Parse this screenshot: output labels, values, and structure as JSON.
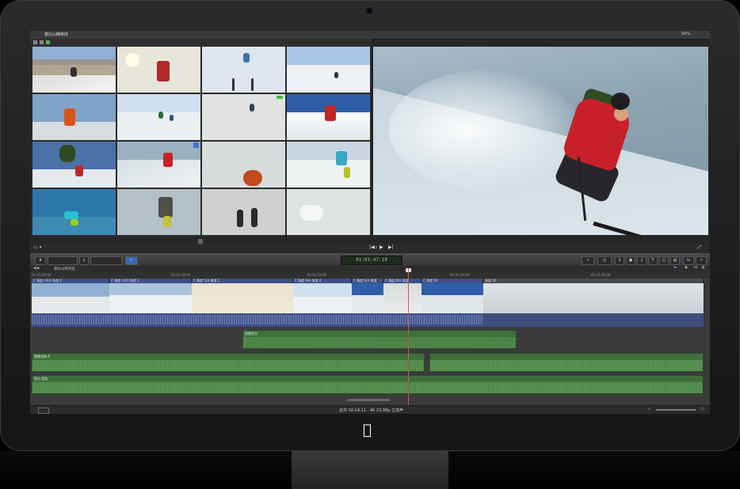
{
  "app": {
    "window_title": "春比山精英娃",
    "zoom_level": "93%",
    "browser_settings_label": "设置"
  },
  "toolbar": {
    "timecode": "01:01:47:10"
  },
  "timeline": {
    "project_name": "春比山精英娃",
    "ruler_ticks": [
      "01:01:00:00",
      "01:01:10:00",
      "01:01:20:00",
      "01:01:30:00",
      "01:01:40:00",
      "01:01:50:00",
      "01:02:00:00"
    ],
    "clips": [
      {
        "label": "C 角度 14(A 角度 4"
      },
      {
        "label": "C 角度 14(A 角度 1"
      },
      {
        "label": "C 角度 5(A 角度 1"
      },
      {
        "label": "C 角度 9(A 角度 4"
      },
      {
        "label": "C 角度 6(A 角度"
      },
      {
        "label": "C 角度 8(A 角度"
      },
      {
        "label": "C 角度 10"
      },
      {
        "label": "角度 10"
      }
    ],
    "audio_tracks": [
      {
        "label": "背景音乐"
      },
      {
        "label": "滑雪音效 A"
      },
      {
        "label": "旁白 音效"
      }
    ],
    "status": "总共 02:14:11 · 4K 23.98p 立体声"
  },
  "colors": {
    "clip_blue": "#3d4f86",
    "audio_green": "#3f6e3c",
    "playhead": "#e05050",
    "timecode_green": "#9ec59e"
  }
}
